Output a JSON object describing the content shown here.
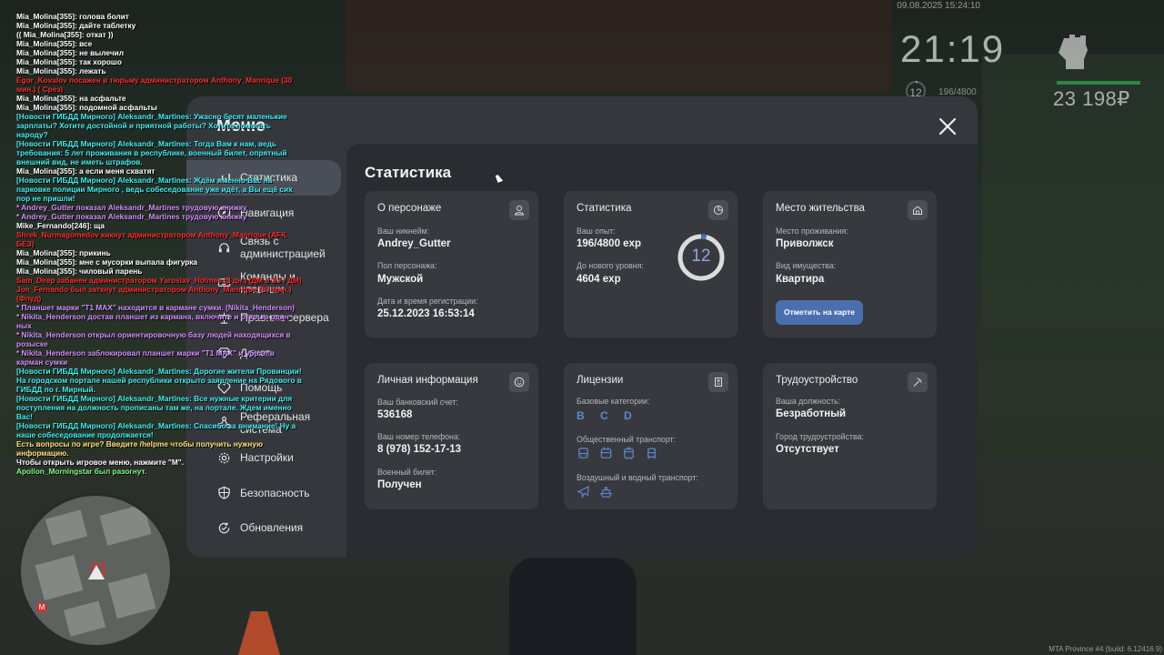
{
  "hud": {
    "datetime": "09.08.2025 15:24:10",
    "time": "21:19",
    "level": "12",
    "exp": "196/4800",
    "money": "23 198₽",
    "build": "MTA Province #4 (build: 6.12416.9)"
  },
  "chat": [
    {
      "text": "Mia_Molina[355]: голова болит",
      "color": "#ffffff"
    },
    {
      "text": "Mia_Molina[355]: дайте таблетку",
      "color": "#ffffff"
    },
    {
      "text": "(( Mia_Molina[355]: откат ))",
      "color": "#ffffff"
    },
    {
      "text": "Mia_Molina[355]: все",
      "color": "#ffffff"
    },
    {
      "text": "Mia_Molina[355]: не вылечил",
      "color": "#ffffff"
    },
    {
      "text": "Mia_Molina[355]: так хорошо",
      "color": "#ffffff"
    },
    {
      "text": "Mia_Molina[355]: лежать",
      "color": "#ffffff"
    },
    {
      "text": "Egor_Kovalov посажен в тюрьму администратором Anthony_Manrique (30 мин.) ( Срез)",
      "color": "#ff2a2a"
    },
    {
      "text": "Mia_Molina[355]: на асфальте",
      "color": "#ffffff"
    },
    {
      "text": "Mia_Molina[355]: подомной асфальты",
      "color": "#ffffff"
    },
    {
      "text": "[Новости ГИБДД Мирного] Aleksandr_Martines: Ужасно бесят маленькие зарплаты? Хотите достойной и приятной работы? Хотите помогать народу?",
      "color": "#3ff0f0"
    },
    {
      "text": "[Новости ГИБДД Мирного] Aleksandr_Martines: Тогда Вам к нам, ведь требования: 5 лет проживания в республике, военный билет, опрятный внешний вид, не иметь штрафов.",
      "color": "#3ff0f0"
    },
    {
      "text": "Mia_Molina[355]: а если меня схватят",
      "color": "#ffffff"
    },
    {
      "text": "[Новости ГИБДД Мирного] Aleksandr_Martines: Ждём именно Вас на парковке полиции Мирного , ведь собеседование уже идёт, а Вы ещё сих пор не пришли!",
      "color": "#3ff0f0"
    },
    {
      "text": " * Andrey_Gutter показал Aleksandr_Martines трудовую книжку",
      "color": "#d68cff"
    },
    {
      "text": " * Andrey_Gutter показал Aleksandr_Martines трудовую книжку",
      "color": "#d68cff"
    },
    {
      "text": "Mike_Fernando[246]: ща",
      "color": "#ffffff"
    },
    {
      "text": "Shrek_Nurmagomedov кикнут администратором Anthony_Manrique (AFK БЕЗ)",
      "color": "#ff2a2a"
    },
    {
      "text": "Mia_Molina[355]: прикинь",
      "color": "#ffffff"
    },
    {
      "text": "Mia_Molina[355]: мне с мусорки выпала фигурка",
      "color": "#ffffff"
    },
    {
      "text": "Mia_Molina[355]: чиловый парень",
      "color": "#ffffff"
    },
    {
      "text": "Sam_Deep забанен администратором Yaroslav_Holmes (3 дн.) (ДМ в ЗЗ / ДМ)",
      "color": "#ff2a2a"
    },
    {
      "text": "Jon_Fernando был заткнут администратором Anthony_Manrique (30 мин.) (Флуд)",
      "color": "#ff2a2a"
    },
    {
      "text": " * Планшет марки \"T1 MAX\" находится в кармане сумки. (Nikita_Henderson)",
      "color": "#d68cff"
    },
    {
      "text": " * Nikita_Henderson достав планшет из кармана, включите и открыв один ных",
      "color": "#d68cff"
    },
    {
      "text": " * Nikita_Henderson открыл ориентировочную базу людей находящихся в розыске",
      "color": "#d68cff"
    },
    {
      "text": " * Nikita_Henderson заблокировал планшет марки \"T1 MAX\" и убрал в карман сумки",
      "color": "#d68cff"
    },
    {
      "text": "[Новости ГИБДД Мирного] Aleksandr_Martines: Дорогие жители Провинции! На городском портале нашей республики открыто заявление на Рядового в ГИБДД по г. Мирный.",
      "color": "#3ff0f0"
    },
    {
      "text": "[Новости ГИБДД Мирного] Aleksandr_Martines: Все нужные критерии для поступления на должность прописаны там же, на портале. Ждем именно Вас!",
      "color": "#3ff0f0"
    },
    {
      "text": "[Новости ГИБДД Мирного] Aleksandr_Martines: Спасибо за внимание! Ну а наше собеседование продолжается!",
      "color": "#3ff0f0"
    },
    {
      "text": "Есть вопросы по игре? Введите /helpme чтобы получить нужную информацию.",
      "color": "#ffe07a"
    },
    {
      "text": "Чтобы открыть игровое меню, нажмите \"M\".",
      "color": "#ffffff"
    },
    {
      "text": "Apollon_Morningstar был разогнут.",
      "color": "#7dff7d"
    }
  ],
  "menu": {
    "title": "Меню",
    "sidebar": [
      {
        "label": "Статистика",
        "icon": "chart-icon"
      },
      {
        "label": "Навигация",
        "icon": "compass-icon"
      },
      {
        "label": "Связь с администрацией",
        "icon": "headset-icon"
      },
      {
        "label": "Команды и клавиши",
        "icon": "keyboard-icon"
      },
      {
        "label": "Правила сервера",
        "icon": "scales-icon"
      },
      {
        "label": "Донат",
        "icon": "diamond-icon"
      },
      {
        "label": "Помощь",
        "icon": "heart-icon"
      },
      {
        "label": "Реферальная система",
        "icon": "network-icon"
      },
      {
        "label": "Настройки",
        "icon": "gear-icon"
      },
      {
        "label": "Безопасность",
        "icon": "shield-icon"
      },
      {
        "label": "Обновления",
        "icon": "refresh-icon"
      }
    ],
    "page_title": "Статистика",
    "character": {
      "title": "О персонаже",
      "nickname_label": "Ваш никнейм:",
      "nickname": "Andrey_Gutter",
      "gender_label": "Пол персонажа:",
      "gender": "Мужской",
      "reg_label": "Дата и время регистрации:",
      "reg": "25.12.2023 16:53:14"
    },
    "stats": {
      "title": "Статистика",
      "exp_label": "Ваш опыт:",
      "exp": "196/4800 exp",
      "next_label": "До нового уровня:",
      "next": "4604 exp",
      "level": "12",
      "progress": 0.04
    },
    "residence": {
      "title": "Место жительства",
      "place_label": "Место проживания:",
      "place": "Приволжск",
      "property_label": "Вид имущества:",
      "property": "Квартира",
      "map_button": "Отметить на карте"
    },
    "personal": {
      "title": "Личная информация",
      "bank_label": "Ваш банковский счет:",
      "bank": "536168",
      "phone_label": "Ваш номер телефона:",
      "phone": "8 (978) 152-17-13",
      "military_label": "Военный билет:",
      "military": "Получен"
    },
    "licenses": {
      "title": "Лицензии",
      "base_label": "Базовые категории:",
      "base": "B C D",
      "public_label": "Общественный транспорт:",
      "air_label": "Воздушный и водный транспорт:"
    },
    "employment": {
      "title": "Трудоустройство",
      "position_label": "Ваша должность:",
      "position": "Безработный",
      "city_label": "Город трудоустройства:",
      "city": "Отсутствует"
    }
  }
}
